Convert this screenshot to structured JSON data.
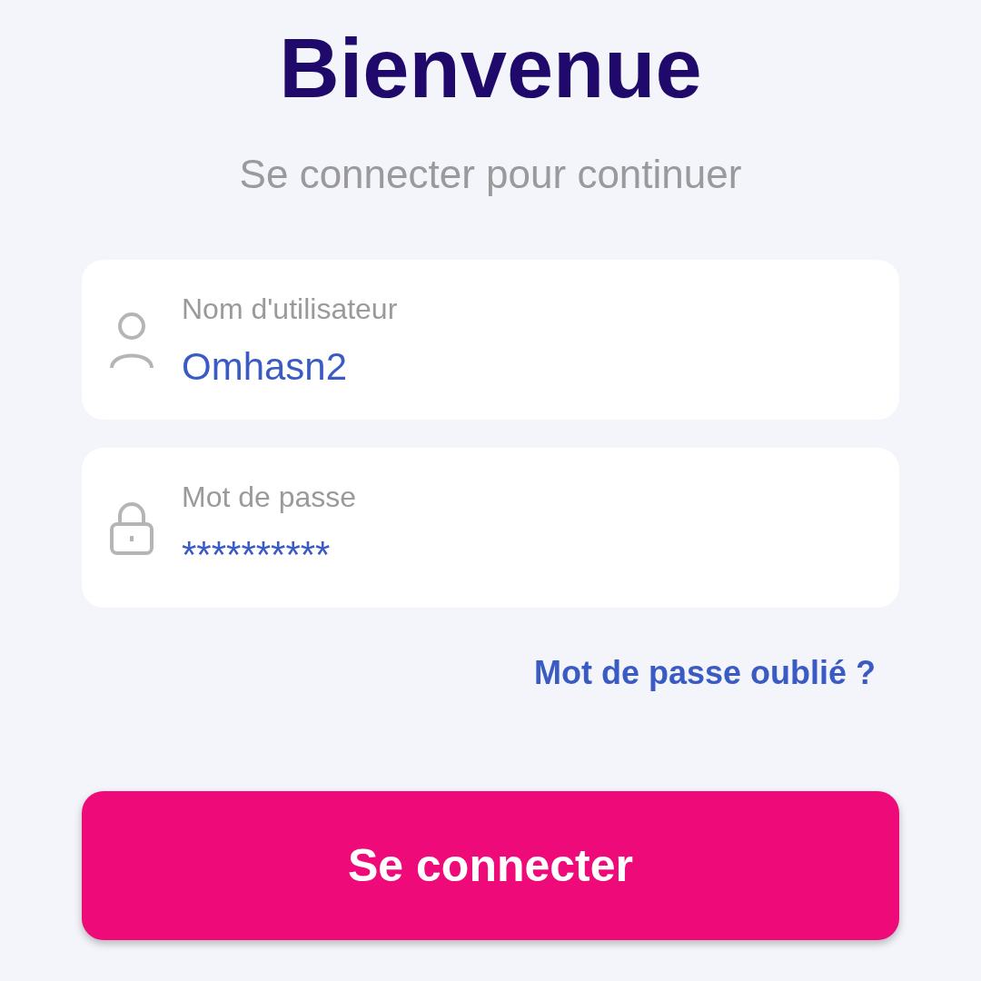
{
  "title": "Bienvenue",
  "subtitle": "Se connecter pour continuer",
  "fields": [
    {
      "kind": "user",
      "label": "Nom d'utilisateur",
      "value": "Omhasn2"
    },
    {
      "kind": "lock",
      "label": "Mot de passe",
      "value": "**********"
    }
  ],
  "forgot_link": "Mot de passe oublié ?",
  "submit_button": "Se connecter"
}
